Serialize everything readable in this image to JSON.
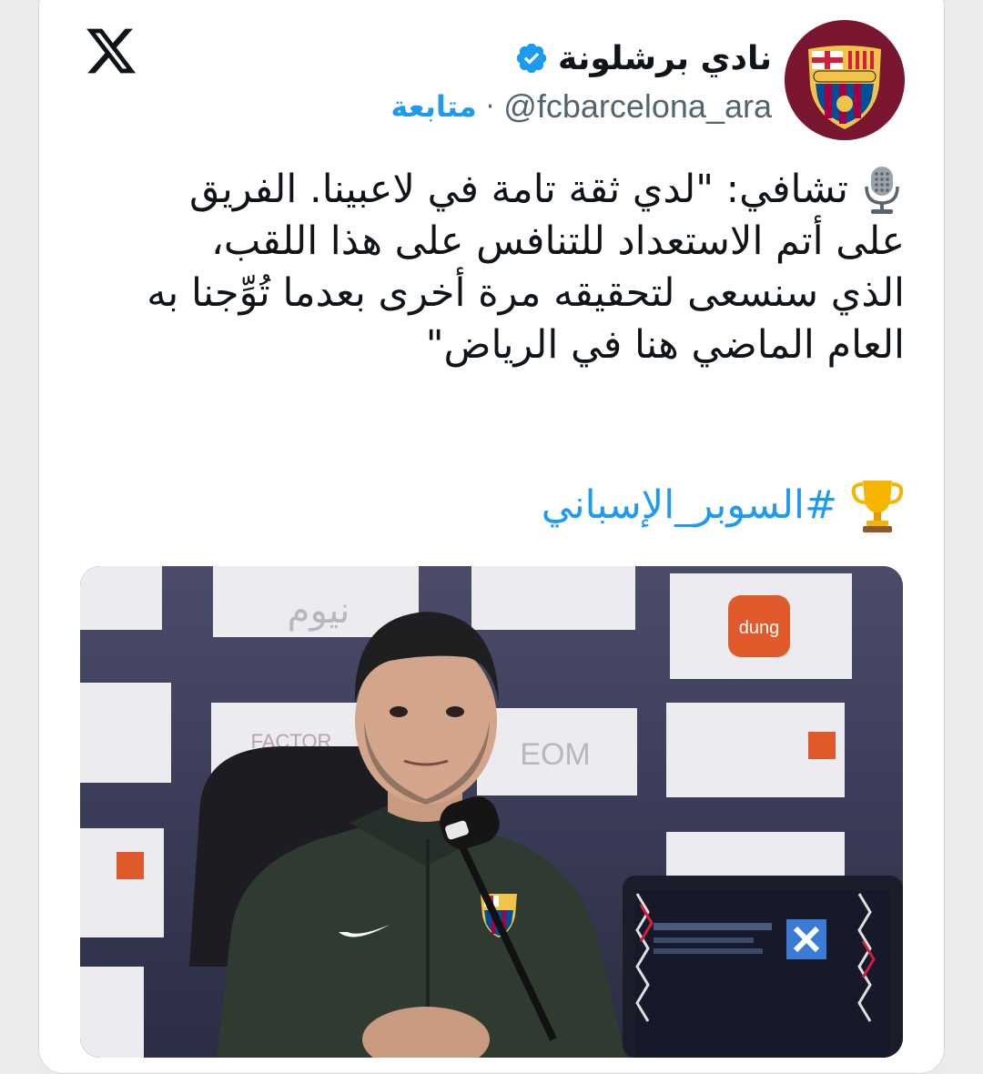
{
  "header": {
    "display_name": "نادي برشلونة",
    "handle": "@fcbarcelona_ara",
    "separator": "·",
    "follow_label": "متابعة",
    "avatar_text": "FCB"
  },
  "tweet": {
    "lines": [
      "تشافي: \"لدي ثقة تامة في لاعبينا. الفريق",
      "على أتم الاستعداد للتنافس على هذا اللقب،",
      "الذي سنسعى لتحقيقه مرة أخرى بعدما تُوِّجنا به",
      "العام الماضي هنا في الرياض\""
    ],
    "hashtag": "#السوبر_الإسباني"
  },
  "icons": {
    "platform_logo": "x-logo-icon",
    "verified": "verified-badge-icon",
    "microphone": "studio-microphone-icon",
    "trophy": "trophy-icon"
  },
  "media": {
    "backdrop_text": [
      "نيوم",
      "EOM",
      "FACTOR",
      "dung"
    ],
    "crest_text": "FCB"
  },
  "colors": {
    "link": "#1d9bf0",
    "text": "#0f1419",
    "secondary": "#536471",
    "club_maroon": "#7a1630",
    "club_blue": "#004d98",
    "club_red": "#a50044"
  }
}
